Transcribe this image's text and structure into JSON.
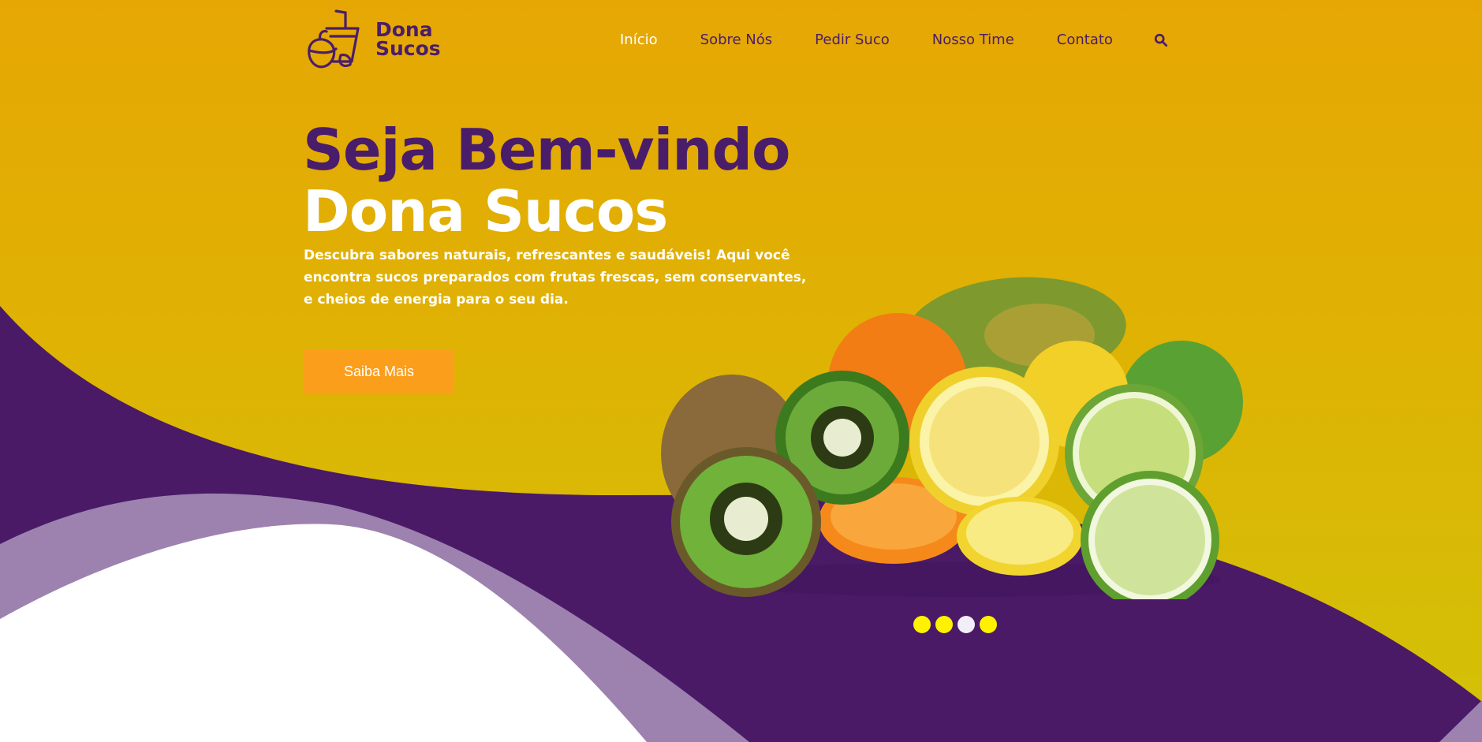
{
  "brand": {
    "line1": "Dona",
    "line2": "Sucos",
    "logo_icon": "juice-cup-fruit-icon"
  },
  "nav": {
    "items": [
      {
        "label": "Início",
        "active": true
      },
      {
        "label": "Sobre Nós",
        "active": false
      },
      {
        "label": "Pedir Suco",
        "active": false
      },
      {
        "label": "Nosso Time",
        "active": false
      },
      {
        "label": "Contato",
        "active": false
      }
    ],
    "search_icon": "search-icon"
  },
  "hero": {
    "title_line1": "Seja Bem-vindo",
    "title_line2": "Dona Sucos",
    "description": "Descubra sabores naturais, refrescantes e saudáveis! Aqui você encontra sucos preparados com frutas frescas, sem conservantes, e cheios de energia para o seu dia.",
    "cta_label": "Saiba Mais"
  },
  "carousel": {
    "total": 4,
    "active_index": 2
  },
  "colors": {
    "primary_purple": "#4a1d6a",
    "gold_top": "#e6a704",
    "gold_bottom": "#d2c207",
    "cta_orange": "#fb9e1c",
    "dot_yellow": "#fff200",
    "light_purple": "#9c82b0"
  }
}
